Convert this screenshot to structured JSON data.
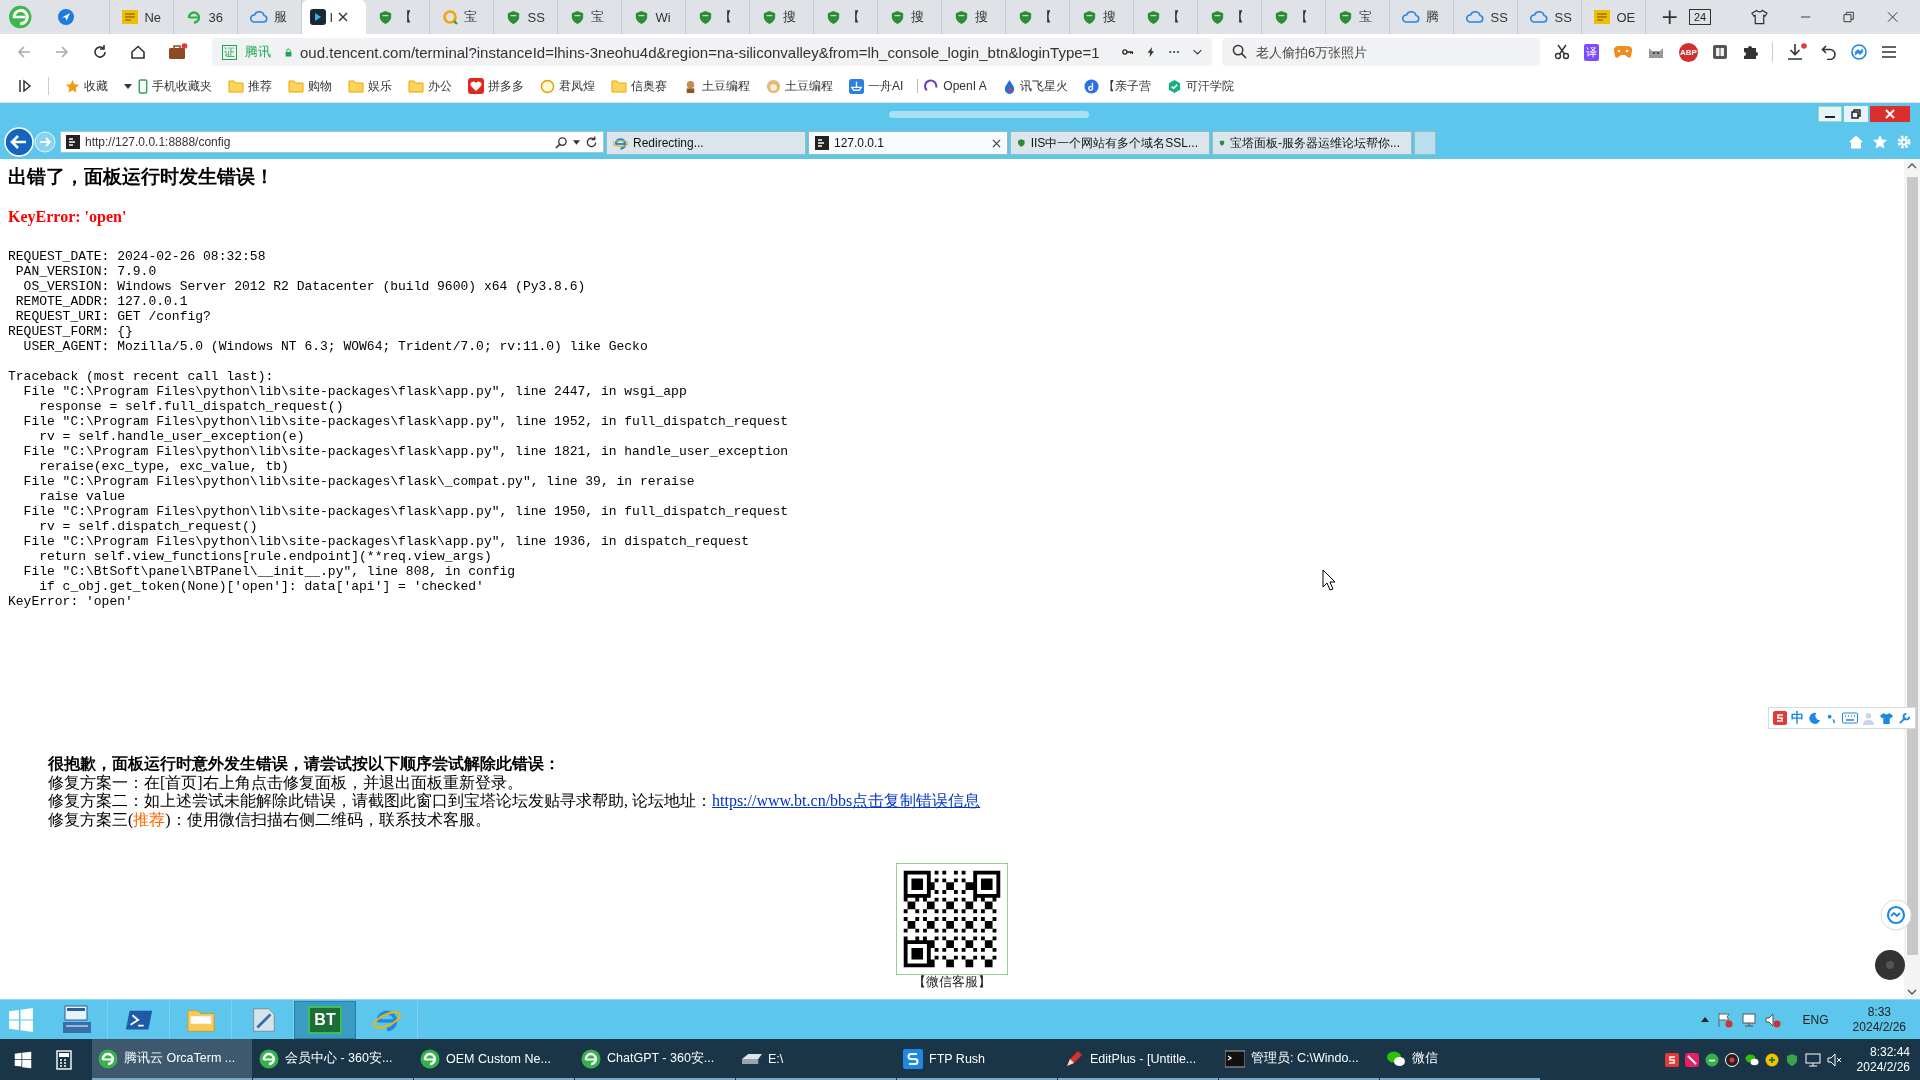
{
  "browser": {
    "tabs": [
      {
        "kind": "compass",
        "selected": false
      },
      {
        "kind": "tile",
        "label": "Ne",
        "selected": false
      },
      {
        "kind": "e360",
        "label": "36",
        "selected": false
      },
      {
        "kind": "cloud",
        "label": "服",
        "selected": false
      },
      {
        "kind": "terminal",
        "label": "I",
        "selected": true
      },
      {
        "kind": "shield",
        "label": "【",
        "selected": false
      },
      {
        "kind": "ring",
        "label": "宝",
        "selected": false
      },
      {
        "kind": "shield",
        "label": "SS",
        "selected": false
      },
      {
        "kind": "shield",
        "label": "宝",
        "selected": false
      },
      {
        "kind": "shield",
        "label": "Wi",
        "selected": false
      },
      {
        "kind": "shield",
        "label": "【",
        "selected": false
      },
      {
        "kind": "shield",
        "label": "搜",
        "selected": false
      },
      {
        "kind": "shield",
        "label": "【",
        "selected": false
      },
      {
        "kind": "shield",
        "label": "搜",
        "selected": false
      },
      {
        "kind": "shield",
        "label": "搜",
        "selected": false
      },
      {
        "kind": "shield",
        "label": "【",
        "selected": false
      },
      {
        "kind": "shield",
        "label": "搜",
        "selected": false
      },
      {
        "kind": "shield",
        "label": "【",
        "selected": false
      },
      {
        "kind": "shield",
        "label": "【",
        "selected": false
      },
      {
        "kind": "shield",
        "label": "【",
        "selected": false
      },
      {
        "kind": "shield",
        "label": "宝",
        "selected": false
      },
      {
        "kind": "cloud",
        "label": "腾",
        "selected": false
      },
      {
        "kind": "cloud",
        "label": "SS",
        "selected": false
      },
      {
        "kind": "cloud",
        "label": "SS",
        "selected": false
      },
      {
        "kind": "tile",
        "label": "OE",
        "selected": false
      }
    ],
    "new_tab": "+",
    "tab_count": "24",
    "address": {
      "badge": "证",
      "site": "腾讯",
      "url": "oud.tencent.com/terminal?instanceId=lhins-3neohu4d&region=na-siliconvalley&from=lh_console_login_btn&loginType=1"
    },
    "search": {
      "placeholder": "老人偷拍6万张照片"
    },
    "translate": "译",
    "adblock": "ABP",
    "bookmarks": [
      {
        "kind": "star",
        "label": "收藏"
      },
      {
        "kind": "phone",
        "label": "手机收藏夹"
      },
      {
        "kind": "folder",
        "label": "推荐"
      },
      {
        "kind": "folder",
        "label": "购物"
      },
      {
        "kind": "folder",
        "label": "娱乐"
      },
      {
        "kind": "folder",
        "label": "办公"
      },
      {
        "kind": "pdd",
        "label": "拼多多"
      },
      {
        "kind": "coin",
        "label": "君凤煌"
      },
      {
        "kind": "folder",
        "label": "信奥赛"
      },
      {
        "kind": "bean",
        "label": "土豆编程"
      },
      {
        "kind": "dog",
        "label": "土豆编程"
      },
      {
        "kind": "zhou",
        "label": "一舟AI"
      },
      {
        "kind": "openi",
        "label": "OpenI A"
      },
      {
        "kind": "spark",
        "label": "讯飞星火"
      },
      {
        "kind": "note",
        "label": "【亲子营"
      },
      {
        "kind": "hex",
        "label": "可汗学院"
      }
    ]
  },
  "remote": {
    "ie": {
      "address": "http://127.0.0.1:8888/config",
      "tabs": [
        {
          "kind": "ie",
          "label": "Redirecting...",
          "selected": false
        },
        {
          "kind": "bt",
          "label": "127.0.0.1",
          "selected": true
        },
        {
          "kind": "shield",
          "label": "IIS中一个网站有多个域名SSL...",
          "selected": false
        },
        {
          "kind": "shield",
          "label": "宝塔面板-服务器运维论坛帮你...",
          "selected": false
        }
      ]
    },
    "page": {
      "title": "出错了，面板运行时发生错误！",
      "error": "KeyError: 'open'",
      "request_info": [
        "REQUEST_DATE: 2024-02-26 08:32:58",
        " PAN_VERSION: 7.9.0",
        "  OS_VERSION: Windows Server 2012 R2 Datacenter (build 9600) x64 (Py3.8.6)",
        " REMOTE_ADDR: 127.0.0.1",
        " REQUEST_URI: GET /config?",
        "REQUEST_FORM: {}",
        "  USER_AGENT: Mozilla/5.0 (Windows NT 6.3; WOW64; Trident/7.0; rv:11.0) like Gecko"
      ],
      "traceback": [
        "Traceback (most recent call last):",
        "  File \"C:\\Program Files\\python\\lib\\site-packages\\flask\\app.py\", line 2447, in wsgi_app",
        "    response = self.full_dispatch_request()",
        "  File \"C:\\Program Files\\python\\lib\\site-packages\\flask\\app.py\", line 1952, in full_dispatch_request",
        "    rv = self.handle_user_exception(e)",
        "  File \"C:\\Program Files\\python\\lib\\site-packages\\flask\\app.py\", line 1821, in handle_user_exception",
        "    reraise(exc_type, exc_value, tb)",
        "  File \"C:\\Program Files\\python\\lib\\site-packages\\flask\\_compat.py\", line 39, in reraise",
        "    raise value",
        "  File \"C:\\Program Files\\python\\lib\\site-packages\\flask\\app.py\", line 1950, in full_dispatch_request",
        "    rv = self.dispatch_request()",
        "  File \"C:\\Program Files\\python\\lib\\site-packages\\flask\\app.py\", line 1936, in dispatch_request",
        "    return self.view_functions[rule.endpoint](**req.view_args)",
        "  File \"C:\\BtSoft\\panel\\BTPanel\\__init__.py\", line 808, in config",
        "    if c_obj.get_token(None)['open']: data['api'] = 'checked'",
        "KeyError: 'open'"
      ],
      "help": {
        "heading": "很抱歉，面板运行时意外发生错误，请尝试按以下顺序尝试解除此错误：",
        "lines": [
          {
            "parts": [
              {
                "kind": "plain",
                "text": "修复方案一：在[首页]右上角点击修复面板，并退出面板重新登录。"
              }
            ]
          },
          {
            "parts": [
              {
                "kind": "plain",
                "text": "修复方案二：如上述尝试未能解除此错误，请截图此窗口到宝塔论坛发贴寻求帮助, 论坛地址："
              },
              {
                "kind": "link",
                "text": "https://www.bt.cn/bbs点击复制错误信息"
              }
            ]
          },
          {
            "parts": [
              {
                "kind": "plain",
                "text": "修复方案三("
              },
              {
                "kind": "highlight",
                "text": "推荐"
              },
              {
                "kind": "plain",
                "text": ")：使用微信扫描右侧二维码，联系技术客服。"
              }
            ]
          }
        ]
      },
      "qr_caption": "【微信客服】"
    },
    "ime": {
      "mode": "中"
    },
    "taskbar": {
      "pinned": [
        {
          "kind": "server",
          "selected": false
        },
        {
          "kind": "powershell",
          "selected": false
        },
        {
          "kind": "folder",
          "selected": false
        },
        {
          "kind": "notepad",
          "selected": false
        },
        {
          "kind": "bt",
          "label": "BT",
          "selected": true
        },
        {
          "kind": "ie",
          "selected": false
        }
      ],
      "language": "ENG",
      "time": "8:33",
      "date": "2024/2/26"
    }
  },
  "taskbar": {
    "tasks": [
      {
        "kind": "e360",
        "label": "腾讯云 OrcaTerm ...",
        "selected": true
      },
      {
        "kind": "e360",
        "label": "会员中心 - 360安...",
        "selected": false
      },
      {
        "kind": "e360",
        "label": "OEM Custom Ne...",
        "selected": false
      },
      {
        "kind": "e360",
        "label": "ChatGPT - 360安...",
        "selected": false
      },
      {
        "kind": "drive",
        "label": "E:\\",
        "selected": false
      },
      {
        "kind": "ftp",
        "label": "FTP Rush",
        "selected": false
      },
      {
        "kind": "editplus",
        "label": "EditPlus - [Untitle...",
        "selected": false
      },
      {
        "kind": "cmd",
        "label": "管理员: C:\\Windo...",
        "selected": false
      },
      {
        "kind": "wechat",
        "label": "微信",
        "selected": false
      }
    ],
    "time": "8:32:44",
    "date": "2024/2/26"
  }
}
